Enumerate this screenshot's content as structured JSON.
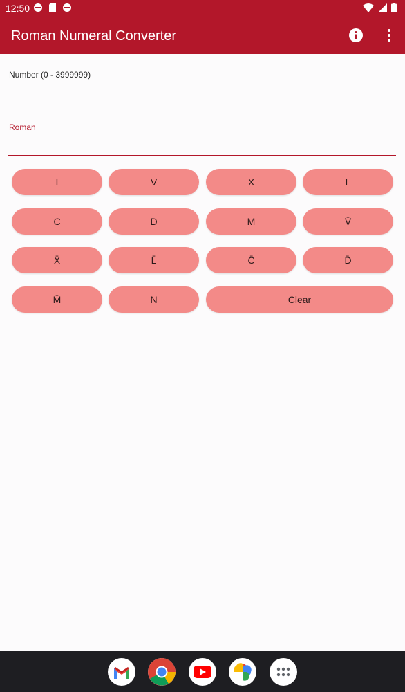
{
  "status_bar": {
    "time": "12:50"
  },
  "app_bar": {
    "title": "Roman Numeral Converter",
    "info_icon": "info-icon",
    "more_icon": "more-vert-icon"
  },
  "fields": {
    "number_label": "Number (0 - 3999999)",
    "number_value": "",
    "roman_label": "Roman",
    "roman_value": ""
  },
  "keypad": {
    "keys": [
      "I",
      "V",
      "X",
      "L",
      "C",
      "D",
      "M",
      "V̄",
      "X̄",
      "L̄",
      "C̄",
      "D̄",
      "M̄",
      "N",
      "Clear"
    ]
  },
  "dock": {
    "apps": [
      "gmail-icon",
      "chrome-icon",
      "youtube-icon",
      "photos-icon",
      "app-drawer-icon"
    ]
  },
  "colors": {
    "primary": "#b3172a",
    "key_fill": "#f38a88",
    "background": "#fcfbfc",
    "nav_bar": "#1e1e22"
  }
}
